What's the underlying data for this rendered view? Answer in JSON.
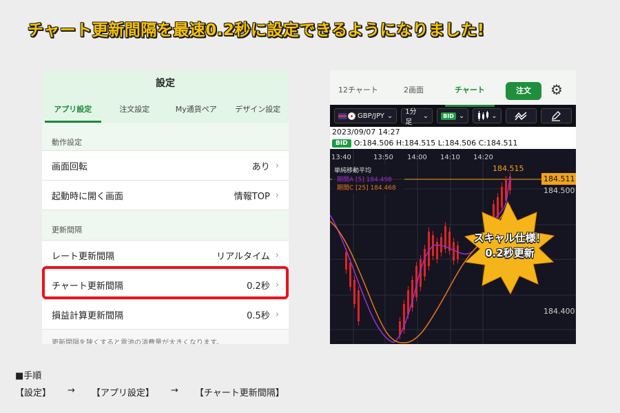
{
  "headline": "チャート更新間隔を最速0.2秒に設定できるようになりました!",
  "settings": {
    "title": "設定",
    "tabs": [
      "アプリ設定",
      "注文設定",
      "My通貨ペア",
      "デザイン設定"
    ],
    "section1": "動作設定",
    "rows1": [
      {
        "label": "画面回転",
        "value": "あり"
      },
      {
        "label": "起動時に開く画面",
        "value": "情報TOP"
      }
    ],
    "section2": "更新間隔",
    "rows2": [
      {
        "label": "レート更新間隔",
        "value": "リアルタイム"
      },
      {
        "label": "チャート更新間隔",
        "value": "0.2秒"
      },
      {
        "label": "損益計算更新間隔",
        "value": "0.5秒"
      }
    ],
    "chevron": "›",
    "footnote": "更新間隔を狭くすると電池の消費量が大きくなります。"
  },
  "chart_panel": {
    "tabs": [
      "12チャート",
      "2画面",
      "チャート"
    ],
    "order_button": "注文",
    "gear_icon": "⚙",
    "pair": "GBP/JPY",
    "timeframe": "1分足",
    "bid_badge": "BID",
    "datetime": "2023/09/07 14:27",
    "ohlc_badge": "BID",
    "ohlc": "O:184.506  H:184.515  L:184.506  C:184.511",
    "times": [
      "13:40",
      "13:50",
      "14:00",
      "14:10",
      "14:20"
    ],
    "legend_title": "単純移動平均",
    "legend_a": "期間A  [5]  184.498",
    "legend_c": "期間C  [25]  184.468",
    "high_label": "184.515",
    "price_tag": "184.511",
    "price_500": "184.500",
    "price_400": "184.400",
    "burst_line1": "スキャル仕様！",
    "burst_line2": "0.2秒更新",
    "colors": {
      "accent": "#1a8a3a",
      "highlight": "#e8141a",
      "burst": "#f5b51a",
      "ma_a": "#9b2fd6",
      "ma_c": "#e8761a",
      "price_tag": "#f2a31a"
    }
  },
  "steps": {
    "heading": "■手順",
    "items": [
      "【設定】",
      "【アプリ設定】",
      "【チャート更新間隔】"
    ],
    "arrow": "→"
  }
}
